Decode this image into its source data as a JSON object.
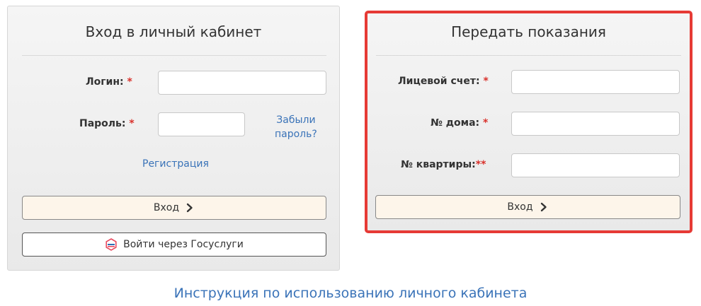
{
  "login": {
    "title": "Вход в личный кабинет",
    "login_label": "Логин:",
    "password_label": "Пароль:",
    "required_mark": "*",
    "login_value": "",
    "password_value": "",
    "forgot_line1": "Забыли",
    "forgot_line2": "пароль?",
    "register_label": "Регистрация",
    "enter_label": "Вход",
    "gosuslugi_label": "Войти через Госуслуги"
  },
  "meter": {
    "title": "Передать показания",
    "account_label": "Лицевой счет:",
    "house_label": "№ дома:",
    "apartment_label": "№ квартиры:",
    "required_mark": "*",
    "double_required_mark": "**",
    "account_value": "",
    "house_value": "",
    "apartment_value": "",
    "enter_label": "Вход"
  },
  "footer": {
    "instructions_label": "Инструкция по использованию личного кабинета"
  },
  "colors": {
    "accent_link": "#3a73b8",
    "highlight_border": "#e63a35",
    "required": "#d9312b"
  }
}
